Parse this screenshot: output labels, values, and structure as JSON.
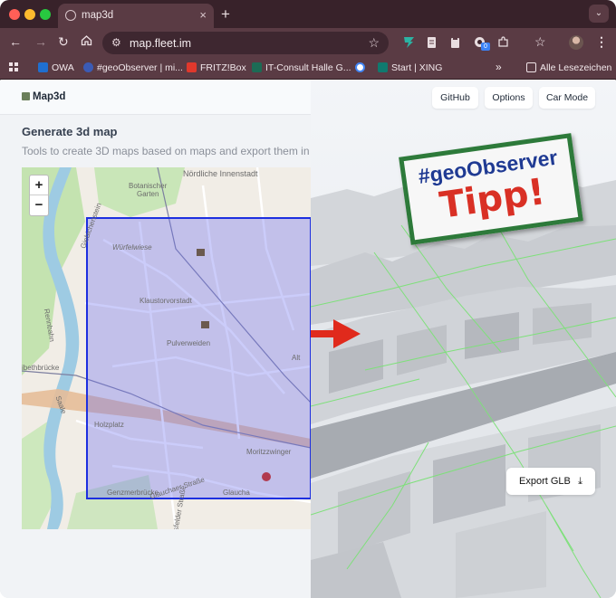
{
  "browser": {
    "tab_title": "map3d",
    "tab_close": "×",
    "new_tab": "+",
    "tab_menu": "⌄",
    "url": "map.fleet.im",
    "bookmarks": [
      {
        "label": "OWA",
        "color": "#1f6fd0"
      },
      {
        "label": "#geoObserver | mi...",
        "color": "#3b5bb5"
      },
      {
        "label": "FRITZ!Box",
        "color": "#e0382c"
      },
      {
        "label": "IT-Consult Halle G...",
        "color": "#1c6b55"
      },
      {
        "label": "",
        "color": "#4285f4"
      },
      {
        "label": "Start | XING",
        "color": "#0f7a6f"
      }
    ],
    "more_bookmarks": "»",
    "all_bookmarks": "Alle Lesezeichen",
    "extension_badge": "0"
  },
  "app": {
    "logo": "Map3d",
    "nav": {
      "github": "GitHub",
      "options": "Options",
      "car_mode": "Car Mode"
    },
    "heading": "Generate 3d map",
    "subtitle": "Tools to create 3D maps based on maps and export them in",
    "zoom_in": "+",
    "zoom_out": "−",
    "export_label": "Export GLB",
    "export_icon": "download-icon"
  },
  "map_labels": {
    "nordliche": "Nördliche Innenstadt",
    "botanischer": "Botanischer",
    "garten": "Garten",
    "wurfelwiese": "Würfelwiese",
    "klaustor": "Klaustorvorstadt",
    "pulverweiden": "Pulverweiden",
    "giebichen": "Giebichenstein",
    "rennbahn": "Rennbahn",
    "ibethbrucke": "ibethbrücke",
    "holzplatz": "Holzplatz",
    "moritz": "Moritzzwinger",
    "glaucha": "Glaucha",
    "genzmer": "Genzmerbrücke",
    "saale": "Saale",
    "mansfelder": "Mansfelder Straße",
    "alt": "Alt",
    "glauchaer": "Glauchaer Straße"
  },
  "overlay": {
    "line1": "#geoObserver",
    "line2": "Tipp!",
    "accent": "#d93025",
    "frame": "#2d7a3a",
    "selection": "#1d2fe0"
  }
}
